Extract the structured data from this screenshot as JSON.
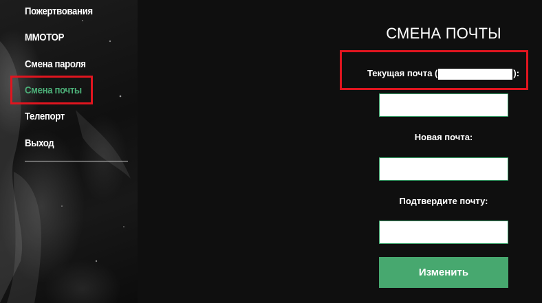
{
  "sidebar": {
    "items": [
      {
        "label": "Пожертвования",
        "active": false
      },
      {
        "label": "MMOTOP",
        "active": false
      },
      {
        "label": "Смена пароля",
        "active": false
      },
      {
        "label": "Смена почты",
        "active": true
      },
      {
        "label": "Телепорт",
        "active": false
      },
      {
        "label": "Выход",
        "active": false
      }
    ]
  },
  "form": {
    "title": "СМЕНА ПОЧТЫ",
    "current_label_prefix": "Текущая почта (",
    "current_label_suffix": "):",
    "new_label": "Новая почта:",
    "confirm_label": "Подтвердите почту:",
    "current_value": "",
    "new_value": "",
    "confirm_value": "",
    "submit_label": "Изменить"
  },
  "colors": {
    "accent_green": "#47a86f",
    "active_menu_green": "#4caf78",
    "annotation_red": "#e0151f",
    "background": "#0f0f0f"
  }
}
